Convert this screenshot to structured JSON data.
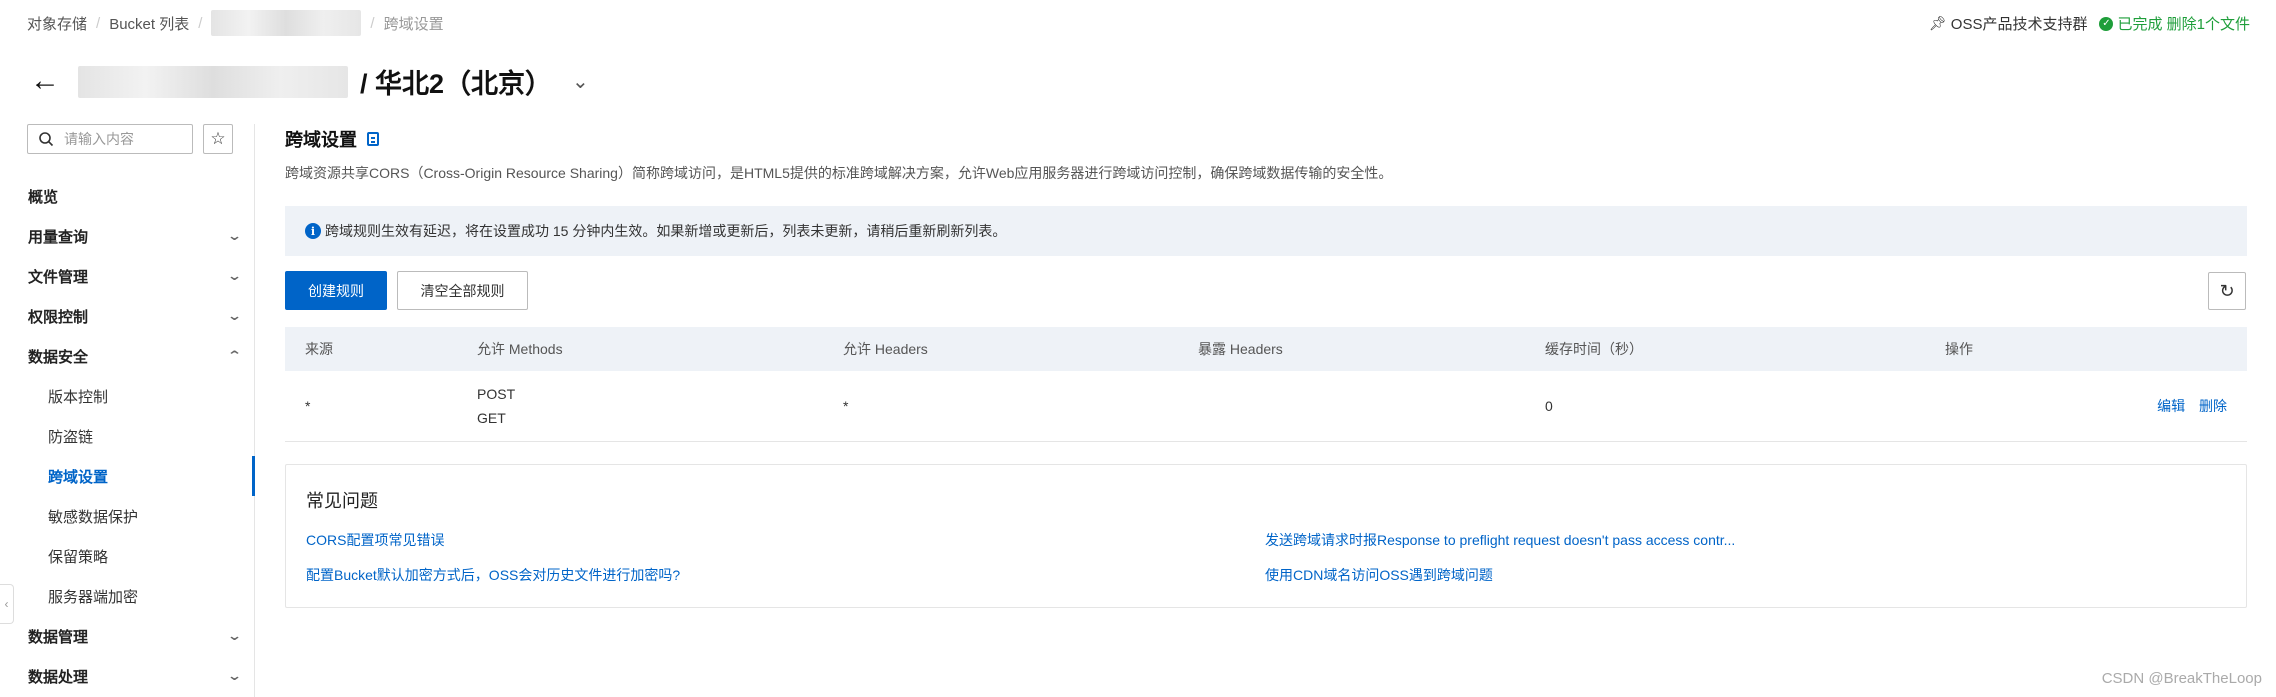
{
  "breadcrumb": {
    "items": [
      "对象存储",
      "Bucket 列表"
    ],
    "current": "跨域设置"
  },
  "topright": {
    "support_link": "OSS产品技术支持群",
    "status_text": "已完成",
    "status_detail": "删除1个文件"
  },
  "header": {
    "region_title": "/ 华北2（北京）"
  },
  "sidebar": {
    "search_placeholder": "请输入内容",
    "items": [
      {
        "label": "概览"
      },
      {
        "label": "用量查询"
      },
      {
        "label": "文件管理"
      },
      {
        "label": "权限控制"
      },
      {
        "label": "数据安全"
      },
      {
        "label": "版本控制"
      },
      {
        "label": "防盗链"
      },
      {
        "label": "跨域设置"
      },
      {
        "label": "敏感数据保护"
      },
      {
        "label": "保留策略"
      },
      {
        "label": "服务器端加密"
      },
      {
        "label": "数据管理"
      },
      {
        "label": "数据处理"
      }
    ]
  },
  "main": {
    "title": "跨域设置",
    "description": "跨域资源共享CORS（Cross-Origin Resource Sharing）简称跨域访问，是HTML5提供的标准跨域解决方案，允许Web应用服务器进行跨域访问控制，确保跨域数据传输的安全性。",
    "notice": "跨域规则生效有延迟，将在设置成功 15 分钟内生效。如果新增或更新后，列表未更新，请稍后重新刷新列表。",
    "create_button": "创建规则",
    "clear_button": "清空全部规则",
    "table": {
      "headers": [
        "来源",
        "允许 Methods",
        "允许 Headers",
        "暴露 Headers",
        "缓存时间（秒）",
        "操作"
      ],
      "rows": [
        {
          "origin": "*",
          "methods": [
            "POST",
            "GET"
          ],
          "allow_headers": "*",
          "expose_headers": "",
          "max_age": "0",
          "edit": "编辑",
          "delete": "删除"
        }
      ]
    }
  },
  "faq": {
    "title": "常见问题",
    "links": [
      "CORS配置项常见错误",
      "发送跨域请求时报Response to preflight request doesn't pass access contr...",
      "配置Bucket默认加密方式后，OSS会对历史文件进行加密吗?",
      "使用CDN域名访问OSS遇到跨域问题"
    ]
  },
  "watermark": "CSDN @BreakTheLoop",
  "colors": {
    "primary": "#0064c8",
    "success": "#1e9e3a",
    "notice_bg": "#eef2f7"
  }
}
